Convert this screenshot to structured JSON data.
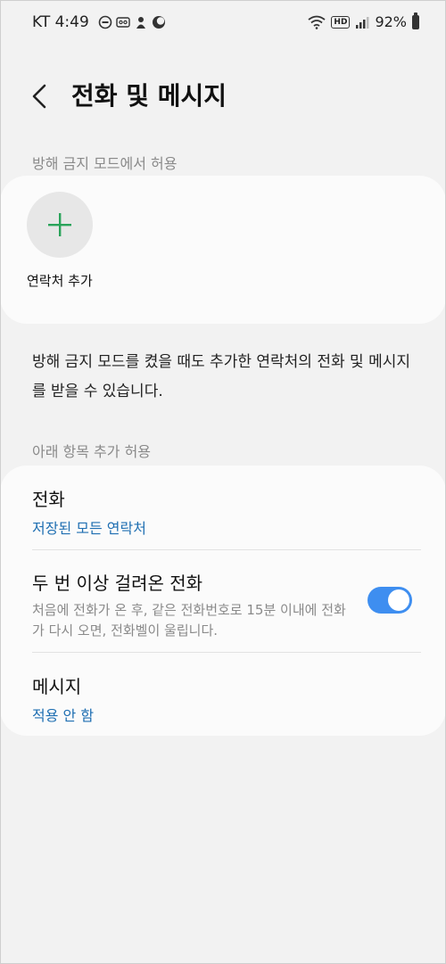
{
  "status_bar": {
    "carrier_time": "KT 4:49",
    "hd": "HD",
    "battery": "92%"
  },
  "header": {
    "title": "전화 및 메시지"
  },
  "dnd_section": {
    "label": "방해 금지 모드에서 허용",
    "add_contact_label": "연락처 추가",
    "description": "방해 금지 모드를 켰을 때도 추가한 연락처의 전화 및 메시지를 받을 수 있습니다."
  },
  "allow_section": {
    "label": "아래 항목 추가 허용",
    "items": [
      {
        "title": "전화",
        "subtitle": "저장된 모든 연락처"
      },
      {
        "title": "두 번 이상 걸려온 전화",
        "description": "처음에 전화가 온 후, 같은 전화번호로 15분 이내에 전화가 다시 오면, 전화벨이 울립니다.",
        "toggle_on": true
      },
      {
        "title": "메시지",
        "subtitle": "적용 안 함"
      }
    ]
  },
  "colors": {
    "accent": "#3e8ef0",
    "link": "#1f6fb2",
    "plus": "#2aa35a"
  }
}
